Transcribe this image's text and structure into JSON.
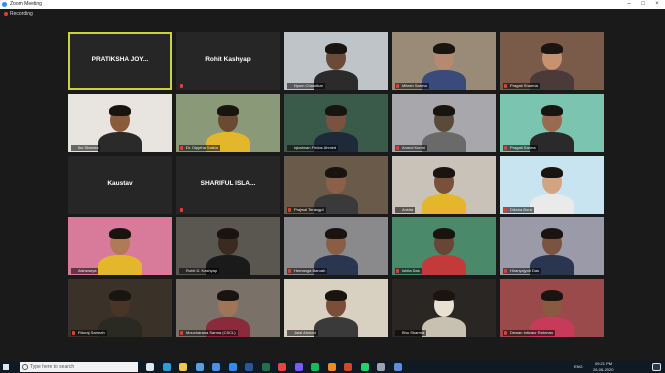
{
  "window": {
    "title": "Zoom Meeting",
    "minimize": "–",
    "maximize": "□",
    "close": "×"
  },
  "recording": {
    "label": "Recording"
  },
  "tiles": [
    {
      "id": "t1",
      "type": "name",
      "name": "PRATIKSHA JOY...",
      "active": true
    },
    {
      "id": "t2",
      "type": "name",
      "name": "Rohit Kashyap",
      "muted": true
    },
    {
      "id": "t3",
      "type": "video",
      "label": "Nyom Chandkar",
      "bg": "#bfc4c9",
      "skin": "#6b4a3a",
      "shirt": "#2b2b2b"
    },
    {
      "id": "t4",
      "type": "video",
      "label": "Mitesh Sarma",
      "muted": true,
      "bg": "#9a8a78",
      "skin": "#b58a70",
      "shirt": "#3a4a7a"
    },
    {
      "id": "t5",
      "type": "video",
      "label": "Pragati Sharma",
      "muted": true,
      "bg": "#7a5a48",
      "skin": "#c69270",
      "shirt": "#4a3a3a"
    },
    {
      "id": "t6",
      "type": "video",
      "label": "Iko Sharma",
      "bg": "#e8e4df",
      "skin": "#8a5a3a",
      "shirt": "#2a2a2a"
    },
    {
      "id": "t7",
      "type": "video",
      "label": "Dr. Dipjeha Saikia",
      "muted": true,
      "bg": "#8a9a78",
      "skin": "#6a4a32",
      "shirt": "#e3b62b"
    },
    {
      "id": "t8",
      "type": "video",
      "label": "Iqbalman Firdos Ahmed",
      "bg": "#3a5a4a",
      "skin": "#7a5240",
      "shirt": "#1e2a3a"
    },
    {
      "id": "t9",
      "type": "video",
      "label": "Anmol Kurmi",
      "muted": true,
      "bg": "#a8a8ac",
      "skin": "#5a4a3a",
      "shirt": "#6a6a6a"
    },
    {
      "id": "t10",
      "type": "video",
      "label": "Pragati Sarma",
      "muted": true,
      "bg": "#7ac4b0",
      "skin": "#9a6a50",
      "shirt": "#2a2a2a"
    },
    {
      "id": "t11",
      "type": "name",
      "name": "Kaustav"
    },
    {
      "id": "t12",
      "type": "name",
      "name": "SHARIFUL ISLA...",
      "muted": true
    },
    {
      "id": "t13",
      "type": "video",
      "label": "Prajwal Terangpi",
      "muted": true,
      "bg": "#6a5a4a",
      "skin": "#8a6048",
      "shirt": "#3a3a3a"
    },
    {
      "id": "t14",
      "type": "video",
      "label": "Ankita",
      "bg": "#c8c2b8",
      "skin": "#7a5038",
      "shirt": "#e3b62b"
    },
    {
      "id": "t15",
      "type": "video",
      "label": "Diksha Bora",
      "muted": true,
      "bg": "#c8e4f0",
      "skin": "#d2a482",
      "shirt": "#eaeaea"
    },
    {
      "id": "t16",
      "type": "video",
      "label": "Aishwarya",
      "bg": "#d87a9a",
      "skin": "#b07a58",
      "shirt": "#e3b62b"
    },
    {
      "id": "t17",
      "type": "video",
      "label": "Rohit D. Kashyap",
      "bg": "#5a5650",
      "skin": "#3a2a20",
      "shirt": "#1a1a1a"
    },
    {
      "id": "t18",
      "type": "video",
      "label": "Hemanga Baruah",
      "muted": true,
      "bg": "#8a8a8c",
      "skin": "#8a5e44",
      "shirt": "#2a3550"
    },
    {
      "id": "t19",
      "type": "video",
      "label": "Ishita Das",
      "muted": true,
      "bg": "#4a8a6a",
      "skin": "#6a4434",
      "shirt": "#c43a3a"
    },
    {
      "id": "t20",
      "type": "video",
      "label": "Hiranyajyoti Das",
      "muted": true,
      "bg": "#9a9aa8",
      "skin": "#7a5440",
      "shirt": "#2a3550"
    },
    {
      "id": "t21",
      "type": "video",
      "label": "Rituraj Sarmah",
      "muted": true,
      "bg": "#3a3228",
      "skin": "#4a3428",
      "shirt": "#2a2a22"
    },
    {
      "id": "t22",
      "type": "video",
      "label": "Moucharana Sarma (CSCL)",
      "muted": true,
      "bg": "#7a7268",
      "skin": "#a07456",
      "shirt": "#8a2a3a"
    },
    {
      "id": "t23",
      "type": "video",
      "label": "Jalal Ahmed",
      "bg": "#d8d0c0",
      "skin": "#7a4e38",
      "shirt": "#3a3a3a"
    },
    {
      "id": "t24",
      "type": "video",
      "label": "Bhu Sharma",
      "bg": "#2a2624",
      "skin": "#e8e0d0",
      "shirt": "#c8c0b0"
    },
    {
      "id": "t25",
      "type": "video",
      "label": "Dewan Intizaur Rahman",
      "muted": true,
      "bg": "#9a4a4a",
      "skin": "#8a5a40",
      "shirt": "#c83a5a"
    }
  ],
  "taskbar": {
    "search_placeholder": "Type here to search",
    "language": "ENG",
    "time": "09:21 PM",
    "date": "26-08-2020",
    "apps": [
      {
        "name": "task-view-icon",
        "color": "#dfe7ee"
      },
      {
        "name": "edge-icon",
        "color": "#2d9cdb"
      },
      {
        "name": "file-explorer-icon",
        "color": "#f2c94c"
      },
      {
        "name": "store-icon",
        "color": "#5aa0e0"
      },
      {
        "name": "mail-icon",
        "color": "#4a90e2"
      },
      {
        "name": "zoom-icon",
        "color": "#2d8cff"
      },
      {
        "name": "word-icon",
        "color": "#2b5797"
      },
      {
        "name": "excel-icon",
        "color": "#217346"
      },
      {
        "name": "chrome-icon",
        "color": "#e8453c"
      },
      {
        "name": "photos-icon",
        "color": "#7a5af8"
      },
      {
        "name": "spotify-icon",
        "color": "#1db954"
      },
      {
        "name": "vlc-icon",
        "color": "#f08a24"
      },
      {
        "name": "powerpoint-icon",
        "color": "#d24726"
      },
      {
        "name": "whatsapp-icon",
        "color": "#25d366"
      },
      {
        "name": "settings-icon",
        "color": "#9aa4ad"
      },
      {
        "name": "zoom-meeting-icon",
        "color": "#5b8ee0"
      }
    ]
  }
}
